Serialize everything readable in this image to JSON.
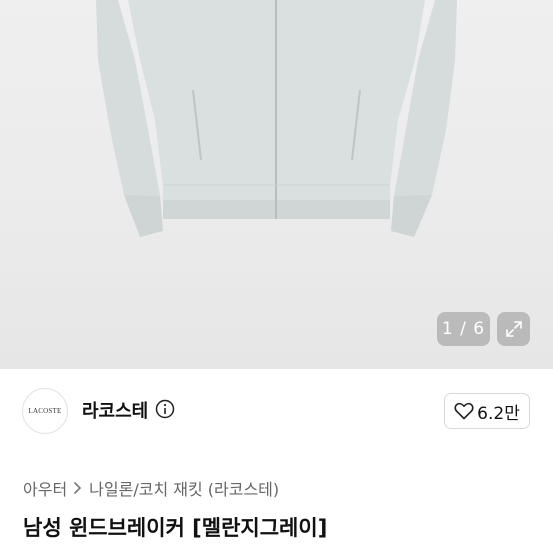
{
  "gallery": {
    "counter": "1 / 6",
    "current_image": 1,
    "total_images": 6,
    "image_subject": "light grey windbreaker jacket",
    "expand_icon": "expand-icon"
  },
  "seller": {
    "avatar_text": "LACOSTE",
    "name": "라코스테",
    "info_icon": "info-icon"
  },
  "like": {
    "icon": "heart-icon",
    "count": "6.2만"
  },
  "breadcrumb": {
    "items": [
      "아우터",
      "나일론/코치 재킷 (라코스테)"
    ]
  },
  "product": {
    "title": "남성 윈드브레이커 [멜란지그레이]"
  },
  "colors": {
    "jacket": "#d7dcdd",
    "gallery_bg": "#ececec",
    "overlay": "#999999"
  }
}
